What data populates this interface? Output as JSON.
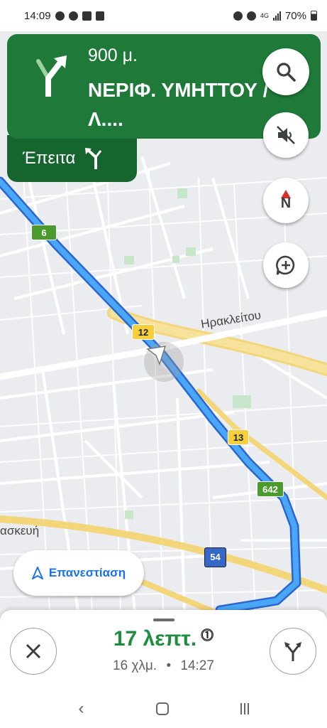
{
  "status_bar": {
    "time": "14:09",
    "network": "4G",
    "battery": "70%"
  },
  "direction": {
    "distance": "900 μ.",
    "street": "ΝΕΡΙΦ. ΥΜΗΤΤΟΥ / Λ....",
    "then_label": "Έπειτα"
  },
  "map": {
    "route_shields": [
      "6",
      "12",
      "13",
      "642",
      "54"
    ],
    "street_labels": {
      "irakleitou": "Ηρακλείτου",
      "partial": "ασκευή"
    }
  },
  "controls": {
    "recenter_label": "Επανεστίαση",
    "compass_label": "N"
  },
  "trip": {
    "minutes": "17 λεπτ.",
    "distance": "16 χλμ.",
    "separator": "•",
    "arrival": "14:27"
  },
  "colors": {
    "route": "#4285f4",
    "banner": "#1f7a3a",
    "eta": "#1e8e3e",
    "primary_blue": "#1a73e8"
  },
  "icons": [
    "facebook-icon",
    "facebook-icon",
    "notification-icon",
    "alert-icon",
    "alarm-icon",
    "location-icon",
    "signal-icon",
    "battery-icon",
    "turn-slight-right-icon",
    "turn-left-fork-icon",
    "search-icon",
    "mute-icon",
    "compass-icon",
    "add-report-icon",
    "navigation-arrow-icon",
    "close-icon",
    "alternate-routes-icon",
    "back-icon",
    "home-icon",
    "recents-icon"
  ]
}
